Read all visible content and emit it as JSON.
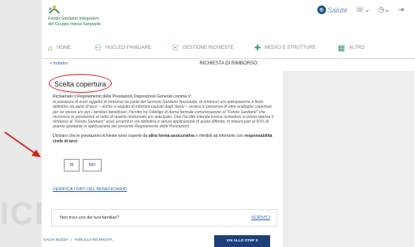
{
  "background": {
    "watermark": "ICB"
  },
  "brand": {
    "org_line1": "Fondo Sanitario Integrativo",
    "org_line2": "del Gruppo Intesa Sanpaolo",
    "powered_by": "Powered by",
    "partner": "Salute"
  },
  "nav": {
    "home": "HOME",
    "family": "NUCLEO FAMILIARE",
    "requests": "GESTIONE RICHIESTE",
    "doctors": "MEDICI E STRUTTURE",
    "other": "ALTRO"
  },
  "subnav": {
    "back": "< Indietro",
    "title": "RICHIESTA DI RIMBORSO"
  },
  "form": {
    "section_title": "Scelta copertura",
    "rule_head": "Richiamato il Regolamento delle Prestazioni Disposizioni Generali comma V:",
    "rule_body": "In presenza di oneri oggetto di rimborso da parte del Servizio Sanitario Nazionale, di rimborso e/o anticipazione a titolo definitivo da parte di terzi – anche a seguito di infortuni causati dagli stessi – ovvero in presenza di altre analoghe coperture per se stesso e/o per i familiari beneficiari, l'iscritto ha l'obbligo di darne formale comunicazione al \"Fondo Sanitario\" che riconosce le prestazioni al netto di quanto rimborsato e/o anticipato. Ove l'iscritto intenda invece richiedere in prima istanza il rimborso al \"Fondo Sanitario\" esso avverrà in via definitiva e senza applicazione di quota differita, in misura pari al 50% di quanto spettante in applicazione del presente Regolamento delle Prestazioni.",
    "declare_pre": "Dichiaro che le prestazioni richieste sono coperte da ",
    "declare_bold1": "altra forma assicurativa",
    "declare_mid": " o riferibili ad infortunio con ",
    "declare_bold2": "responsabilità civile di terzi",
    "yes": "SI",
    "no": "NO",
    "verify_link": "VERIFICA I DATI DEL BENEFICIARIO",
    "not_found": "Non trovi uno dei tuoi familiari?",
    "write_link": "SCRIVICI"
  },
  "footer": {
    "save_draft": "SALVA BOZZA",
    "separator": "|",
    "cancel": "ANNULLA RICHIESTA",
    "next_step": "VAI ALLO STEP 3"
  },
  "colors": {
    "accent": "#1e3f7a",
    "link": "#2b65a8",
    "annotation": "#d8201c",
    "brand_green": "#1b7a3a"
  }
}
